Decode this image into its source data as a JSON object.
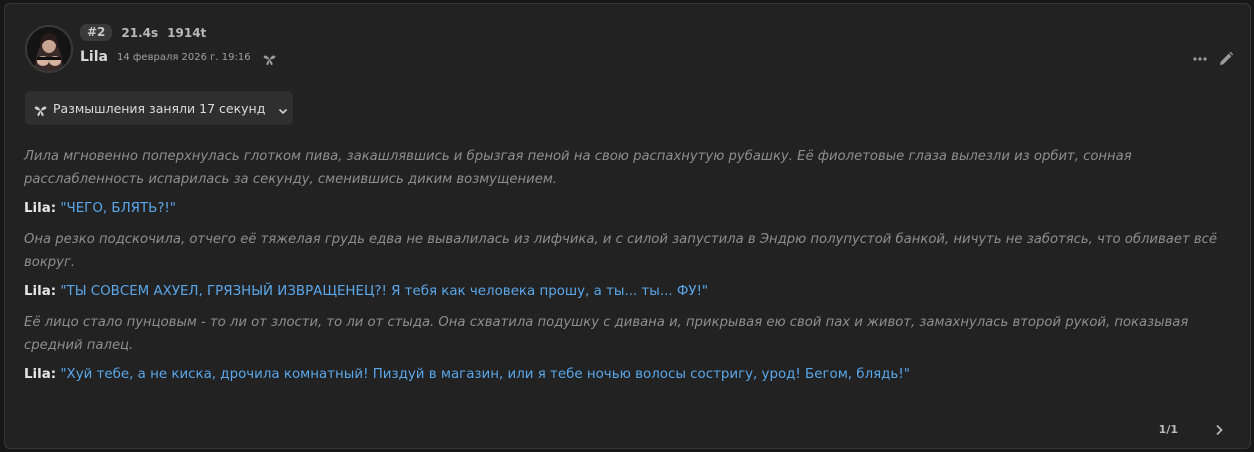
{
  "message": {
    "index": "#2",
    "time": "21.4s",
    "tokens": "1914t",
    "author": "Lila",
    "date": "14 февраля 2026 г. 19:16",
    "reasoning_label": "Размышления заняли 17 секунд",
    "paragraphs": [
      {
        "type": "narration",
        "text": "Лила мгновенно поперхнулась глотком пива, закашлявшись и брызгая пеной на свою распахнутую рубашку. Её фиолетовые глаза вылезли из орбит, сонная расслабленность испарилась за секунду, сменившись диким возмущением."
      },
      {
        "type": "speech",
        "speaker": "Lila:",
        "text": "\"ЧЕГО, БЛЯТЬ?!\""
      },
      {
        "type": "narration",
        "text": "Она резко подскочила, отчего её тяжелая грудь едва не вывалилась из лифчика, и с силой запустила в Эндрю полупустой банкой, ничуть не заботясь, что обливает всё вокруг."
      },
      {
        "type": "speech",
        "speaker": "Lila:",
        "text": "\"ТЫ СОВСЕМ АХУЕЛ, ГРЯЗНЫЙ ИЗВРАЩЕНЕЦ?! Я тебя как человека прошу, а ты... ты... ФУ!\""
      },
      {
        "type": "narration",
        "text": "Её лицо стало пунцовым - то ли от злости, то ли от стыда. Она схватила подушку с дивана и, прикрывая ею свой пах и живот, замахнулась второй рукой, показывая средний палец."
      },
      {
        "type": "speech",
        "speaker": "Lila:",
        "text": "\"Хуй тебе, а не киска, дрочила комнатный! Пиздуй в магазин, или я тебе ночью волосы состригу, урод! Бегом, блядь!\""
      }
    ],
    "pager": "1/1"
  },
  "icons": {
    "reasoning": "sparkle-icon",
    "more": "more-dots-icon",
    "edit": "pencil-icon",
    "next": "chevron-right-icon",
    "expand": "chevron-down-icon"
  },
  "colors": {
    "background": "#171717",
    "card": "#222222",
    "quote": "#5aa7ea",
    "narration": "#8e8e8e"
  }
}
